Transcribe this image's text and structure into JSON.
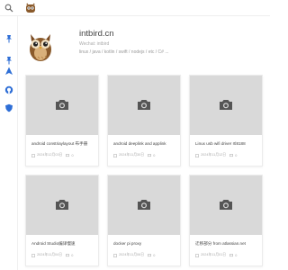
{
  "header": {
    "search_icon": "search-icon",
    "logo_icon": "owl-logo-icon"
  },
  "rail": {
    "icons": [
      "pin-icon",
      "pin-icon",
      "navigate-icon",
      "github-icon",
      "shield-icon"
    ],
    "accent": "#2e6ed6"
  },
  "profile": {
    "title": "intbird.cn",
    "subtitle": "Wechat: intbird",
    "tags": "linux / java / kotlin / swift / nodejs / etc / C# ..."
  },
  "posts": [
    {
      "title": "android constriaylayout 布手册",
      "date": "2024年12月03日",
      "comments": "0"
    },
    {
      "title": "android deeplink and applink",
      "date": "2024年11月30日",
      "comments": "0"
    },
    {
      "title": "Linux usb wifi driver rtl8188",
      "date": "2024年11月12日",
      "comments": "0"
    },
    {
      "title": "Android Studio编译慢速",
      "date": "2024年11月04日",
      "comments": "0"
    },
    {
      "title": "docker pi proxy",
      "date": "2024年11月06日",
      "comments": "0"
    },
    {
      "title": "迁移部分 from atlassian.net",
      "date": "2024年11月01日",
      "comments": "0"
    }
  ],
  "colors": {
    "thumb_bg": "#d9d9d9",
    "owl_brown": "#8a5a2b"
  }
}
